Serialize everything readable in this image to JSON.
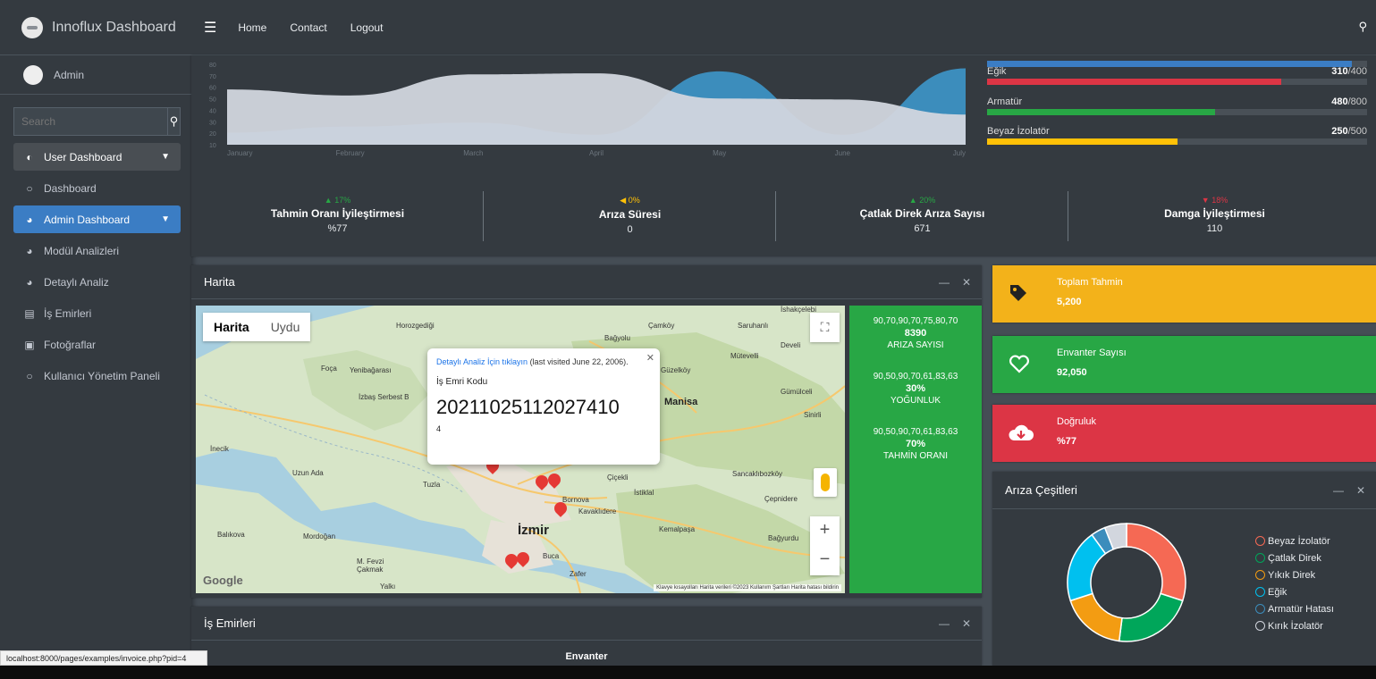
{
  "app": {
    "brand": "Innoflux Dashboard",
    "user": "Admin"
  },
  "search": {
    "placeholder": "Search"
  },
  "sidebar": {
    "items": [
      {
        "label": "User Dashboard",
        "icon": "tachometer-icon"
      },
      {
        "label": "Dashboard",
        "icon": "circle-icon"
      },
      {
        "label": "Admin Dashboard",
        "icon": "pie-chart-icon"
      },
      {
        "label": "Modül Analizleri",
        "icon": "pie-chart-icon"
      },
      {
        "label": "Detaylı Analiz",
        "icon": "pie-chart-icon"
      },
      {
        "label": "İş Emirleri",
        "icon": "id-card-icon"
      },
      {
        "label": "Fotoğraflar",
        "icon": "image-icon"
      },
      {
        "label": "Kullanıcı Yönetim Paneli",
        "icon": "circle-icon"
      }
    ]
  },
  "topnav": {
    "home": "Home",
    "contact": "Contact",
    "logout": "Logout"
  },
  "chart_data": {
    "type": "area",
    "categories": [
      "January",
      "February",
      "March",
      "April",
      "May",
      "June",
      "July"
    ],
    "ytick_labels": [
      "80",
      "70",
      "60",
      "50",
      "40",
      "30",
      "20",
      "10"
    ],
    "series": [
      {
        "values": [
          22,
          28,
          32,
          20,
          83,
          20,
          86
        ],
        "color": "#3c8dbc"
      },
      {
        "values": [
          65,
          59,
          80,
          81,
          56,
          55,
          40
        ],
        "color": "#d2d6de"
      }
    ],
    "ylim": [
      10,
      90
    ]
  },
  "progress": [
    {
      "label": "",
      "value": "",
      "fraction": 0.96,
      "color": "#3b7dc4"
    },
    {
      "label": "Eğik",
      "value": "310",
      "total": "/400",
      "fraction": 0.775,
      "color": "#dc3545"
    },
    {
      "label": "Armatür",
      "value": "480",
      "total": "/800",
      "fraction": 0.6,
      "color": "#28a745"
    },
    {
      "label": "Beyaz İzolatör",
      "value": "250",
      "total": "/500",
      "fraction": 0.5,
      "color": "#ffc107"
    }
  ],
  "stats": [
    {
      "pct": "▲ 17%",
      "title": "Tahmin Oranı İyileştirmesi",
      "value": "%77",
      "color": "#28a745"
    },
    {
      "pct": "◀ 0%",
      "title": "Arıza Süresi",
      "value": "0",
      "color": "#ffc107"
    },
    {
      "pct": "▲ 20%",
      "title": "Çatlak Direk Arıza Sayısı",
      "value": "671",
      "color": "#28a745"
    },
    {
      "pct": "▼ 18%",
      "title": "Damga İyileştirmesi",
      "value": "110",
      "color": "#dc3545"
    }
  ],
  "map_card": {
    "title": "Harita",
    "tab_map": "Harita",
    "tab_sat": "Uydu",
    "popup": {
      "link": "Detaylı Analiz İçin tıklayın",
      "visited": "(last visited June 22, 2006).",
      "code_label": "İş Emri Kodu",
      "code": "20211025112027410",
      "num": "4"
    },
    "cities": {
      "izmir": "İzmir",
      "manisa": "Manisa",
      "foca": "Foça",
      "yenibagarasi": "Yenibağarası",
      "horozgedigi": "Horozgediği",
      "camkoy": "Çamköy",
      "saruhanli": "Saruhanlı",
      "ishakcelebi": "İshakçelebi",
      "bagyolu": "Bağyolu",
      "develi": "Develi",
      "mutevelli": "Mütevelli",
      "guzelkoy": "Güzelköy",
      "gumulceli": "Gümülceli",
      "sinirli": "Sinirli",
      "inecik": "İnecik",
      "uzunada": "Uzun Ada",
      "tuzla": "Tuzla",
      "cicekli": "Çiçekli",
      "istiklal": "İstiklal",
      "sancakli": "Sancaklıbozköy",
      "cepnidere": "Çepnidere",
      "kemalpasa": "Kemalpaşa",
      "bagyurdu": "Bağyurdu",
      "kavaklidere": "Kavaklıdere",
      "buca": "Buca",
      "zafer": "Zafer",
      "mfevzi": "M. Fevzi Çakmak",
      "yalki": "Yalkı",
      "balikova": "Balıkova",
      "mordogan": "Mordoğan",
      "bornova": "Bornova",
      "izbas": "İzbaş Serbest B"
    },
    "google": "Google",
    "attrib": "Klavye kısayolları  Harita verileri ©2023  Kullanım Şartları  Harita hatası bildirin"
  },
  "green_panel": [
    {
      "series": "90,70,90,70,75,80,70",
      "value": "8390",
      "label": "ARIZA SAYISI"
    },
    {
      "series": "90,50,90,70,61,83,63",
      "value": "30%",
      "label": "YOĞUNLUK"
    },
    {
      "series": "90,50,90,70,61,83,63",
      "value": "70%",
      "label": "TAHMİN ORANI"
    }
  ],
  "info_boxes": [
    {
      "title": "Toplam Tahmin",
      "value": "5,200",
      "color": "#f3b21a",
      "icon": "tag-icon"
    },
    {
      "title": "Envanter Sayısı",
      "value": "92,050",
      "color": "#28a745",
      "icon": "heart-icon"
    },
    {
      "title": "Doğruluk",
      "value": "%77",
      "color": "#dc3545",
      "icon": "cloud-download-icon"
    }
  ],
  "ariza_card": {
    "title": "Arıza Çeşitleri",
    "legend": [
      {
        "label": "Beyaz İzolatör",
        "color": "#f56954"
      },
      {
        "label": "Çatlak Direk",
        "color": "#00a65a"
      },
      {
        "label": "Yıkık Direk",
        "color": "#f39c12"
      },
      {
        "label": "Eğik",
        "color": "#00c0ef"
      },
      {
        "label": "Armatür Hatası",
        "color": "#3c8dbc"
      },
      {
        "label": "Kırık İzolatör",
        "color": "#d2d6de"
      }
    ],
    "donut_values": [
      30,
      22,
      18,
      20,
      4,
      6
    ]
  },
  "is_card": {
    "title": "İş Emirleri",
    "sub": "Envanter"
  },
  "statusbar": "localhost:8000/pages/examples/invoice.php?pid=4",
  "tools": {
    "min": "—",
    "close": "✕"
  }
}
